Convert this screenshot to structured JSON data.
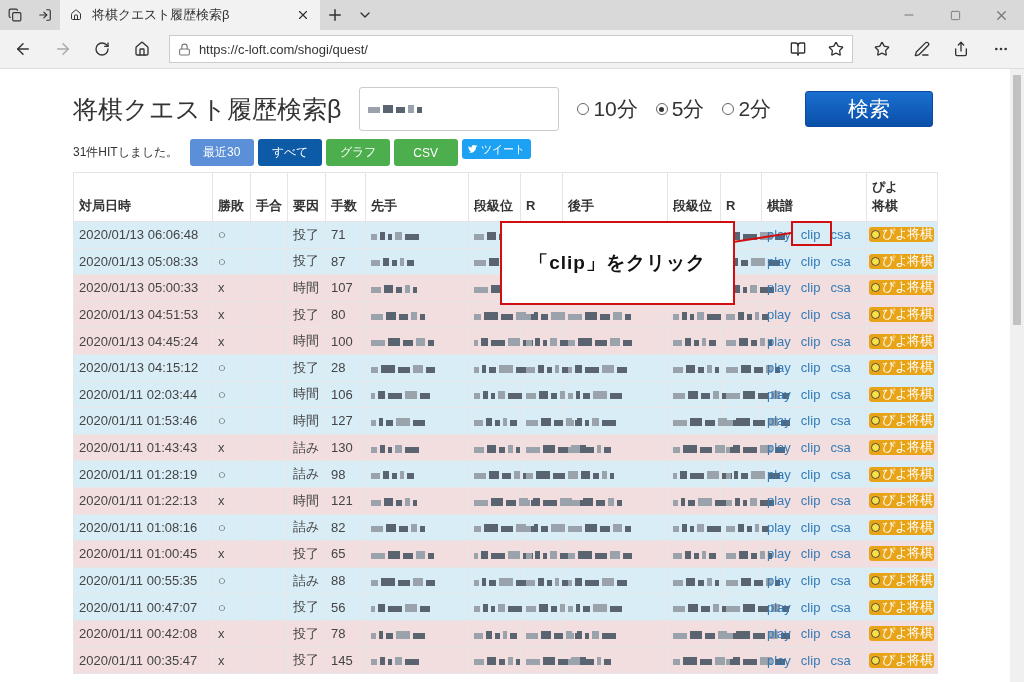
{
  "browser": {
    "tab_title": "将棋クエスト履歴検索β",
    "url": "https://c-loft.com/shogi/quest/"
  },
  "page": {
    "title": "将棋クエスト履歴検索β",
    "time_options": [
      {
        "label": "10分",
        "selected": false
      },
      {
        "label": "5分",
        "selected": true
      },
      {
        "label": "2分",
        "selected": false
      }
    ],
    "search_button": "検索",
    "hit_count": "31件HITしました。",
    "filter_buttons": [
      {
        "label": "最近30",
        "kind": "light"
      },
      {
        "label": "すべて",
        "kind": "dark"
      },
      {
        "label": "グラフ",
        "kind": "green"
      },
      {
        "label": "CSV",
        "kind": "green"
      }
    ],
    "tweet_button": "ツイート"
  },
  "table": {
    "columns": [
      "対局日時",
      "勝敗",
      "手合",
      "要因",
      "手数",
      "先手",
      "段級位",
      "R",
      "後手",
      "段級位",
      "R",
      "棋譜",
      "ぴよ将棋"
    ],
    "rows": [
      {
        "date": "2020/01/13 06:06:48",
        "result": "○",
        "kind": "win",
        "reason": "投了",
        "moves": "71",
        "links": [
          "play",
          "clip",
          "csa"
        ],
        "piyo_badge": "ぴよ将棋"
      },
      {
        "date": "2020/01/13 05:08:33",
        "result": "○",
        "kind": "win",
        "reason": "投了",
        "moves": "87",
        "links": [
          "play",
          "clip",
          "csa"
        ],
        "piyo_badge": "ぴよ将棋"
      },
      {
        "date": "2020/01/13 05:00:33",
        "result": "x",
        "kind": "loss",
        "reason": "時間",
        "moves": "107",
        "links": [
          "play",
          "clip",
          "csa"
        ],
        "piyo_badge": "ぴよ将棋"
      },
      {
        "date": "2020/01/13 04:51:53",
        "result": "x",
        "kind": "loss",
        "reason": "投了",
        "moves": "80",
        "links": [
          "play",
          "clip",
          "csa"
        ],
        "piyo_badge": "ぴよ将棋"
      },
      {
        "date": "2020/01/13 04:45:24",
        "result": "x",
        "kind": "loss",
        "reason": "時間",
        "moves": "100",
        "links": [
          "play",
          "clip",
          "csa"
        ],
        "piyo_badge": "ぴよ将棋"
      },
      {
        "date": "2020/01/13 04:15:12",
        "result": "○",
        "kind": "win",
        "reason": "投了",
        "moves": "28",
        "links": [
          "play",
          "clip",
          "csa"
        ],
        "piyo_badge": "ぴよ将棋"
      },
      {
        "date": "2020/01/11 02:03:44",
        "result": "○",
        "kind": "win",
        "reason": "時間",
        "moves": "106",
        "links": [
          "play",
          "clip",
          "csa"
        ],
        "piyo_badge": "ぴよ将棋"
      },
      {
        "date": "2020/01/11 01:53:46",
        "result": "○",
        "kind": "win",
        "reason": "時間",
        "moves": "127",
        "links": [
          "play",
          "clip",
          "csa"
        ],
        "piyo_badge": "ぴよ将棋"
      },
      {
        "date": "2020/01/11 01:43:43",
        "result": "x",
        "kind": "loss",
        "reason": "詰み",
        "moves": "130",
        "links": [
          "play",
          "clip",
          "csa"
        ],
        "piyo_badge": "ぴよ将棋"
      },
      {
        "date": "2020/01/11 01:28:19",
        "result": "○",
        "kind": "win",
        "reason": "詰み",
        "moves": "98",
        "links": [
          "play",
          "clip",
          "csa"
        ],
        "piyo_badge": "ぴよ将棋"
      },
      {
        "date": "2020/01/11 01:22:13",
        "result": "x",
        "kind": "loss",
        "reason": "時間",
        "moves": "121",
        "links": [
          "play",
          "clip",
          "csa"
        ],
        "piyo_badge": "ぴよ将棋"
      },
      {
        "date": "2020/01/11 01:08:16",
        "result": "○",
        "kind": "win",
        "reason": "詰み",
        "moves": "82",
        "links": [
          "play",
          "clip",
          "csa"
        ],
        "piyo_badge": "ぴよ将棋"
      },
      {
        "date": "2020/01/11 01:00:45",
        "result": "x",
        "kind": "loss",
        "reason": "投了",
        "moves": "65",
        "links": [
          "play",
          "clip",
          "csa"
        ],
        "piyo_badge": "ぴよ将棋"
      },
      {
        "date": "2020/01/11 00:55:35",
        "result": "○",
        "kind": "win",
        "reason": "詰み",
        "moves": "88",
        "links": [
          "play",
          "clip",
          "csa"
        ],
        "piyo_badge": "ぴよ将棋"
      },
      {
        "date": "2020/01/11 00:47:07",
        "result": "○",
        "kind": "win",
        "reason": "投了",
        "moves": "56",
        "links": [
          "play",
          "clip",
          "csa"
        ],
        "piyo_badge": "ぴよ将棋"
      },
      {
        "date": "2020/01/11 00:42:08",
        "result": "x",
        "kind": "loss",
        "reason": "投了",
        "moves": "78",
        "links": [
          "play",
          "clip",
          "csa"
        ],
        "piyo_badge": "ぴよ将棋"
      },
      {
        "date": "2020/01/11 00:35:47",
        "result": "x",
        "kind": "loss",
        "reason": "投了",
        "moves": "145",
        "links": [
          "play",
          "clip",
          "csa"
        ],
        "piyo_badge": "ぴよ将棋"
      }
    ]
  },
  "callout": {
    "text": "「clip」をクリック"
  }
}
